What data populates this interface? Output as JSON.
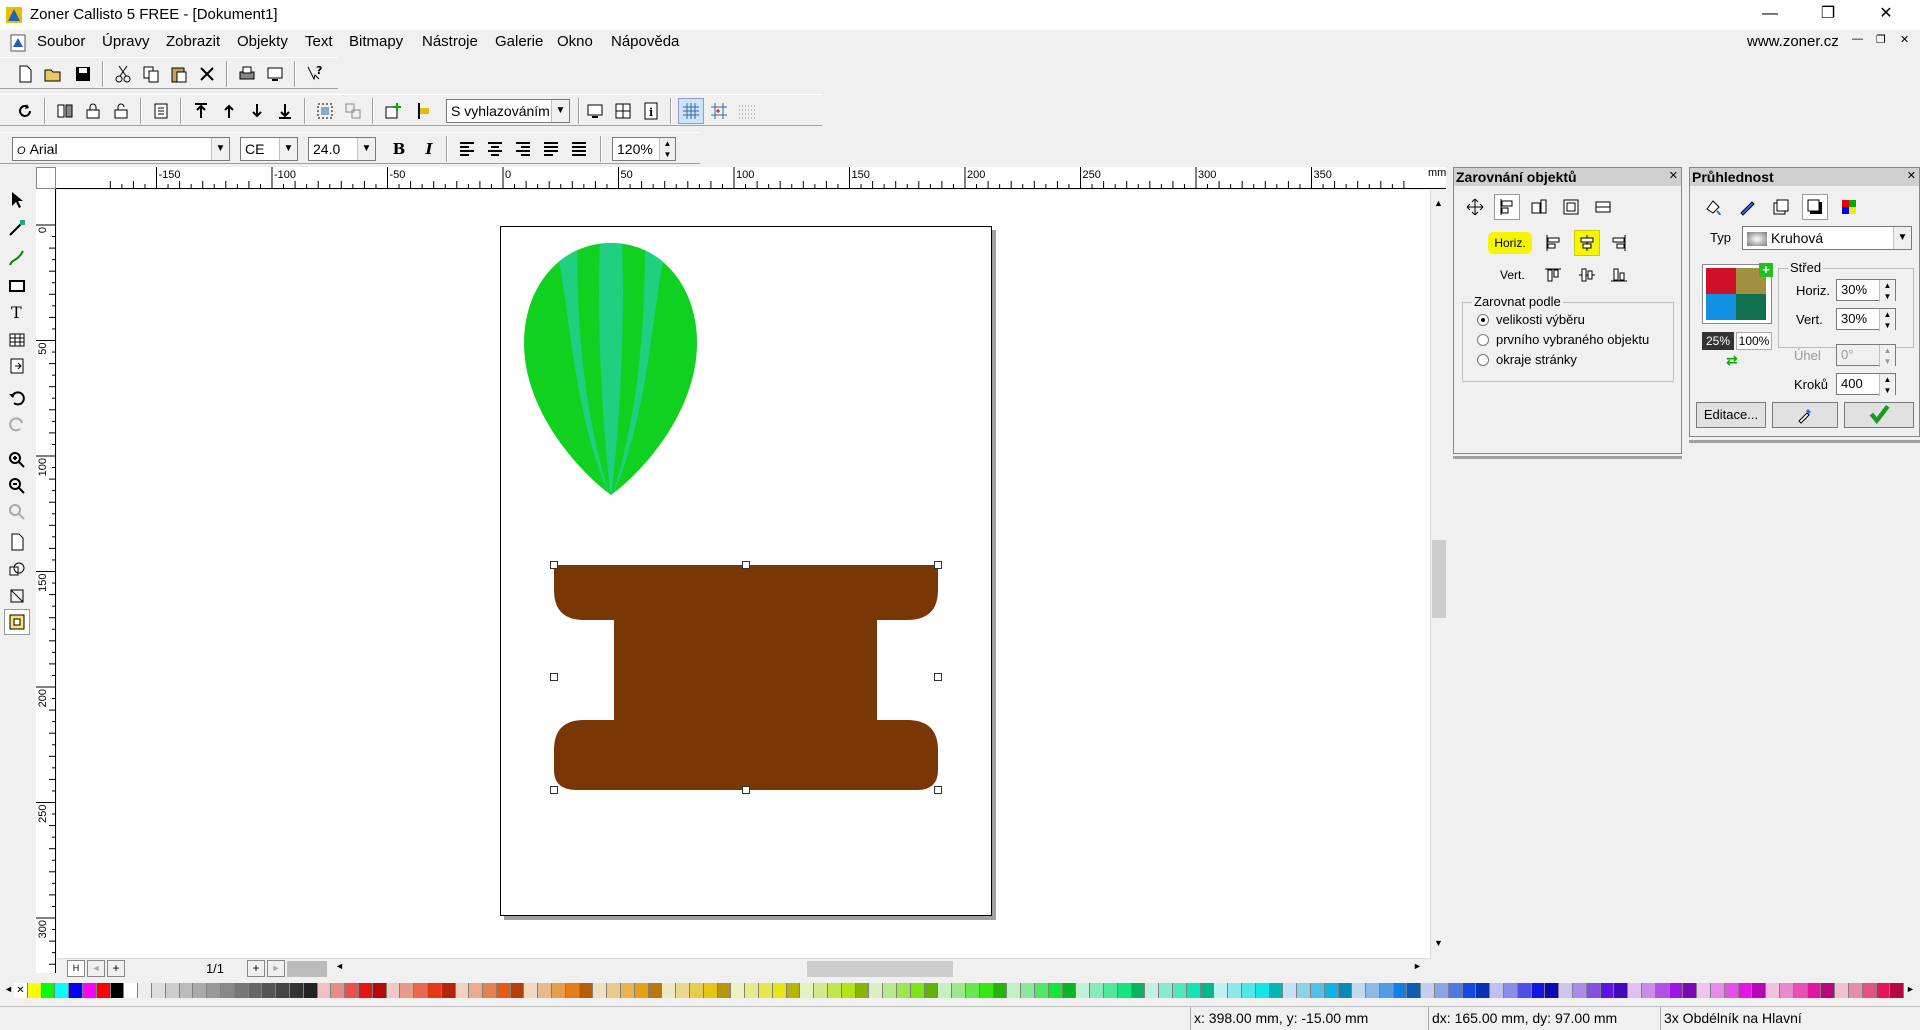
{
  "window": {
    "title": "Zoner Callisto 5 FREE - [Dokument1]",
    "minimize": "—",
    "maximize": "❐",
    "close": "✕"
  },
  "menubar": {
    "items": [
      "Soubor",
      "Úpravy",
      "Zobrazit",
      "Objekty",
      "Text",
      "Bitmapy",
      "Nástroje",
      "Galerie",
      "Okno",
      "Nápověda"
    ],
    "website": "www.zoner.cz"
  },
  "toolbar2": {
    "smoothing": "S vyhlazováním"
  },
  "toolbar3": {
    "font": "Arial",
    "charset": "CE",
    "size": "24.0",
    "bold": "B",
    "italic": "I",
    "zoom": "120%"
  },
  "ruler": {
    "unit": "mm",
    "h_ticks": [
      "-150",
      "-100",
      "-50",
      "0",
      "50",
      "100",
      "150",
      "200",
      "250",
      "300",
      "350"
    ],
    "v_ticks": [
      "0",
      "50",
      "100",
      "150",
      "200",
      "250",
      "300"
    ]
  },
  "page_nav": {
    "counter": "1/1"
  },
  "align_panel": {
    "title": "Zarovnání objektů",
    "horiz_label": "Horiz.",
    "vert_label": "Vert.",
    "group_label": "Zarovnat podle",
    "options": [
      "velikosti výběru",
      "prvního vybraného objektu",
      "okraje stránky"
    ],
    "selected": 0
  },
  "transparency_panel": {
    "title": "Průhlednost",
    "type_label": "Typ",
    "type_value": "Kruhová",
    "center_label": "Střed",
    "horiz_label": "Horiz.",
    "horiz_value": "30%",
    "vert_label": "Vert.",
    "vert_value": "30%",
    "start_pct": "25%",
    "end_pct": "100%",
    "angle_label": "Úhel",
    "angle_value": "0°",
    "steps_label": "Kroků",
    "steps_value": "400",
    "edit_button": "Editace..."
  },
  "status": {
    "coords": "x: 398.00 mm, y: -15.00 mm",
    "delta": "dx: 165.00 mm, dy: 97.00 mm",
    "selection": "3x Obdélník na Hlavní"
  },
  "colors": {
    "balloon_light": "#20d080",
    "balloon_dark": "#10d020",
    "basket": "#7a3706",
    "highlight": "#f5f500"
  }
}
